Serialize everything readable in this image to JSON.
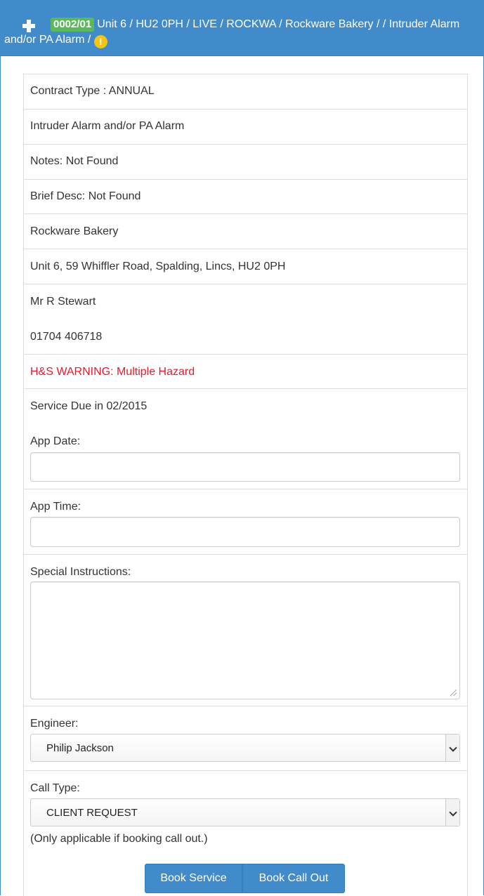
{
  "header": {
    "badge": "0002/01",
    "title": "Unit 6 / HU2 0PH / LIVE / ROCKWA / Rockware Bakery / / Intruder Alarm and/or PA Alarm /",
    "warning_icon": "exclamation-circle-icon",
    "colors": {
      "heading_bg": "#428bca",
      "badge_bg": "#5cb85c",
      "warning": "#f0c419"
    }
  },
  "details": {
    "contract_type": "Contract Type : ANNUAL",
    "system_type": "Intruder Alarm and/or PA Alarm",
    "notes": "Notes: Not Found",
    "brief_desc": "Brief Desc: Not Found",
    "customer": "Rockware Bakery",
    "address": "Unit 6, 59 Whiffler Road, Spalding, Lincs, HU2 0PH",
    "contact_name": "Mr R Stewart",
    "contact_phone": "01704 406718",
    "hs_warning": "H&S WARNING: Multiple Hazard",
    "hs_warning_color": "#e8192c",
    "service_due": "Service Due in 02/2015"
  },
  "form": {
    "app_date_label": "App Date:",
    "app_date_value": "",
    "app_time_label": "App Time:",
    "app_time_value": "",
    "special_instructions_label": "Special Instructions:",
    "special_instructions_value": "",
    "engineer_label": "Engineer:",
    "engineer_selected": "Philip Jackson",
    "call_type_label": "Call Type:",
    "call_type_selected": "CLIENT REQUEST",
    "call_type_note": "(Only applicable if booking call out.)"
  },
  "actions": {
    "book_service": "Book Service",
    "book_call_out": "Book Call Out"
  }
}
